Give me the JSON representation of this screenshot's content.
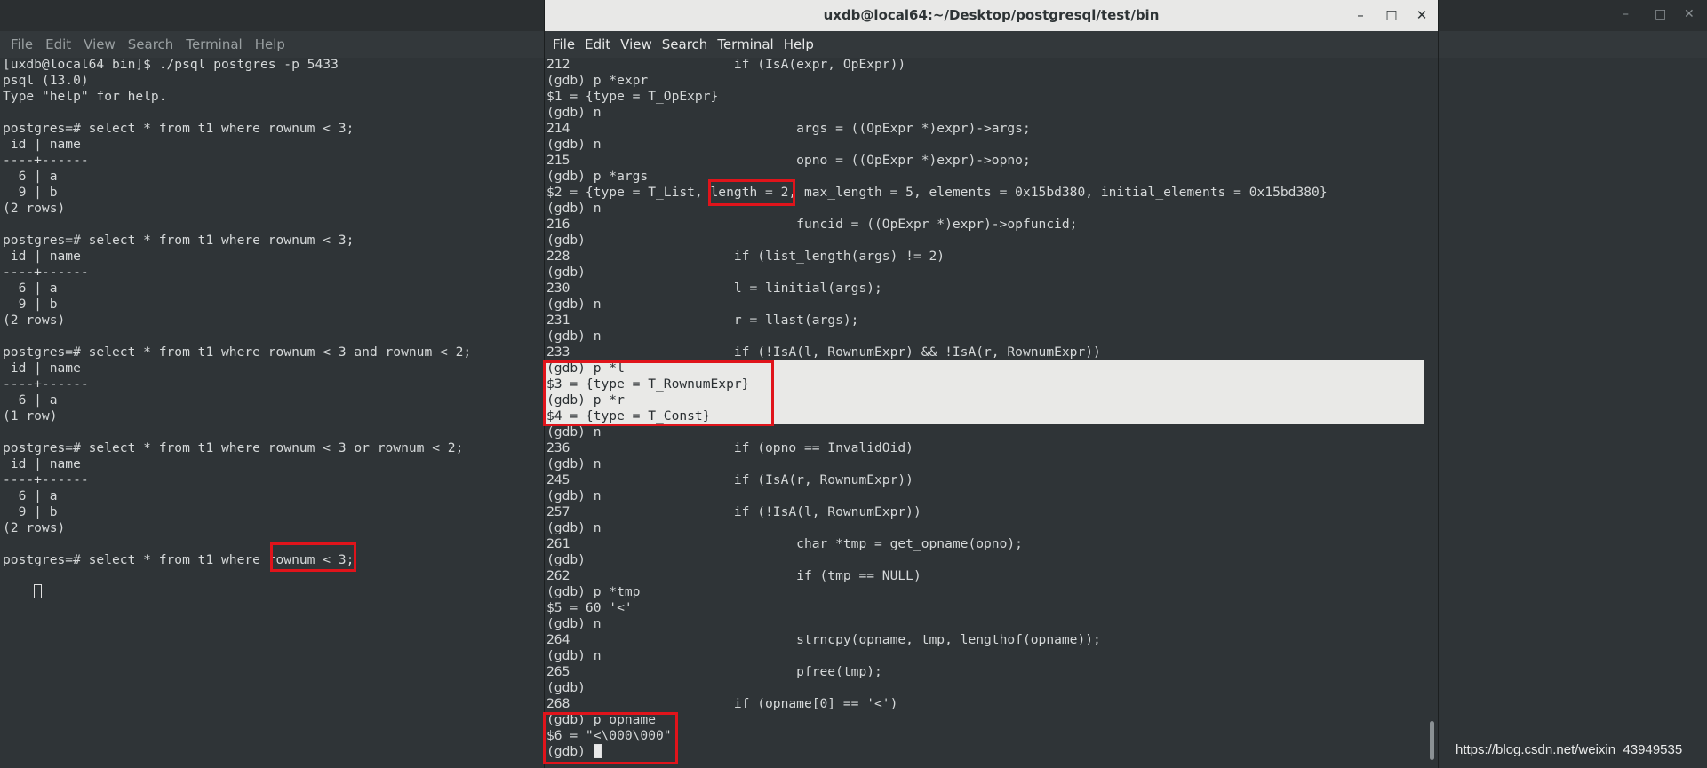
{
  "left_window": {
    "menu": [
      "File",
      "Edit",
      "View",
      "Search",
      "Terminal",
      "Help"
    ],
    "window_controls": [
      "minimize-icon",
      "maximize-icon",
      "close-icon"
    ],
    "lines": [
      "[uxdb@local64 bin]$ ./psql postgres -p 5433",
      "psql (13.0)",
      "Type \"help\" for help.",
      "",
      "postgres=# select * from t1 where rownum < 3;",
      " id | name",
      "----+------",
      "  6 | a",
      "  9 | b",
      "(2 rows)",
      "",
      "postgres=# select * from t1 where rownum < 3;",
      " id | name",
      "----+------",
      "  6 | a",
      "  9 | b",
      "(2 rows)",
      "",
      "postgres=# select * from t1 where rownum < 3 and rownum < 2;",
      " id | name",
      "----+------",
      "  6 | a",
      "(1 row)",
      "",
      "postgres=# select * from t1 where rownum < 3 or rownum < 2;",
      " id | name",
      "----+------",
      "  6 | a",
      "  9 | b",
      "(2 rows)",
      "",
      "postgres=# select * from t1 where rownum < 3;"
    ]
  },
  "right_window": {
    "title": "uxdb@local64:~/Desktop/postgresql/test/bin",
    "menu": [
      "File",
      "Edit",
      "View",
      "Search",
      "Terminal",
      "Help"
    ],
    "window_controls": [
      "minimize-icon",
      "maximize-icon",
      "close-icon"
    ],
    "lines": [
      "212                     if (IsA(expr, OpExpr))",
      "(gdb) p *expr",
      "$1 = {type = T_OpExpr}",
      "(gdb) n",
      "214                             args = ((OpExpr *)expr)->args;",
      "(gdb) n",
      "215                             opno = ((OpExpr *)expr)->opno;",
      "(gdb) p *args",
      "$2 = {type = T_List, length = 2, max_length = 5, elements = 0x15bd380, initial_elements = 0x15bd380}",
      "(gdb) n",
      "216                             funcid = ((OpExpr *)expr)->opfuncid;",
      "(gdb)",
      "228                     if (list_length(args) != 2)",
      "(gdb)",
      "230                     l = linitial(args);",
      "(gdb) n",
      "231                     r = llast(args);",
      "(gdb) n",
      "233                     if (!IsA(l, RownumExpr) && !IsA(r, RownumExpr))",
      "(gdb) p *l",
      "$3 = {type = T_RownumExpr}",
      "(gdb) p *r",
      "$4 = {type = T_Const}",
      "(gdb) n",
      "236                     if (opno == InvalidOid)",
      "(gdb) n",
      "245                     if (IsA(r, RownumExpr))",
      "(gdb) n",
      "257                     if (!IsA(l, RownumExpr))",
      "(gdb) n",
      "261                             char *tmp = get_opname(opno);",
      "(gdb)",
      "262                             if (tmp == NULL)",
      "(gdb) p *tmp",
      "$5 = 60 '<'",
      "(gdb) n",
      "264                             strncpy(opname, tmp, lengthof(opname));",
      "(gdb) n",
      "265                             pfree(tmp);",
      "(gdb)",
      "268                     if (opname[0] == '<')",
      "(gdb) p opname",
      "$6 = \"<\\000\\000\"",
      "(gdb) "
    ]
  },
  "watermark": "https://blog.csdn.net/weixin_43949535",
  "colors": {
    "terminal_bg": "#2f3437",
    "terminal_fg": "#d5d8d9",
    "titlebar": "#e8e8e7",
    "highlight_box": "#e0141b",
    "selection_band": "#e9e9e7"
  }
}
